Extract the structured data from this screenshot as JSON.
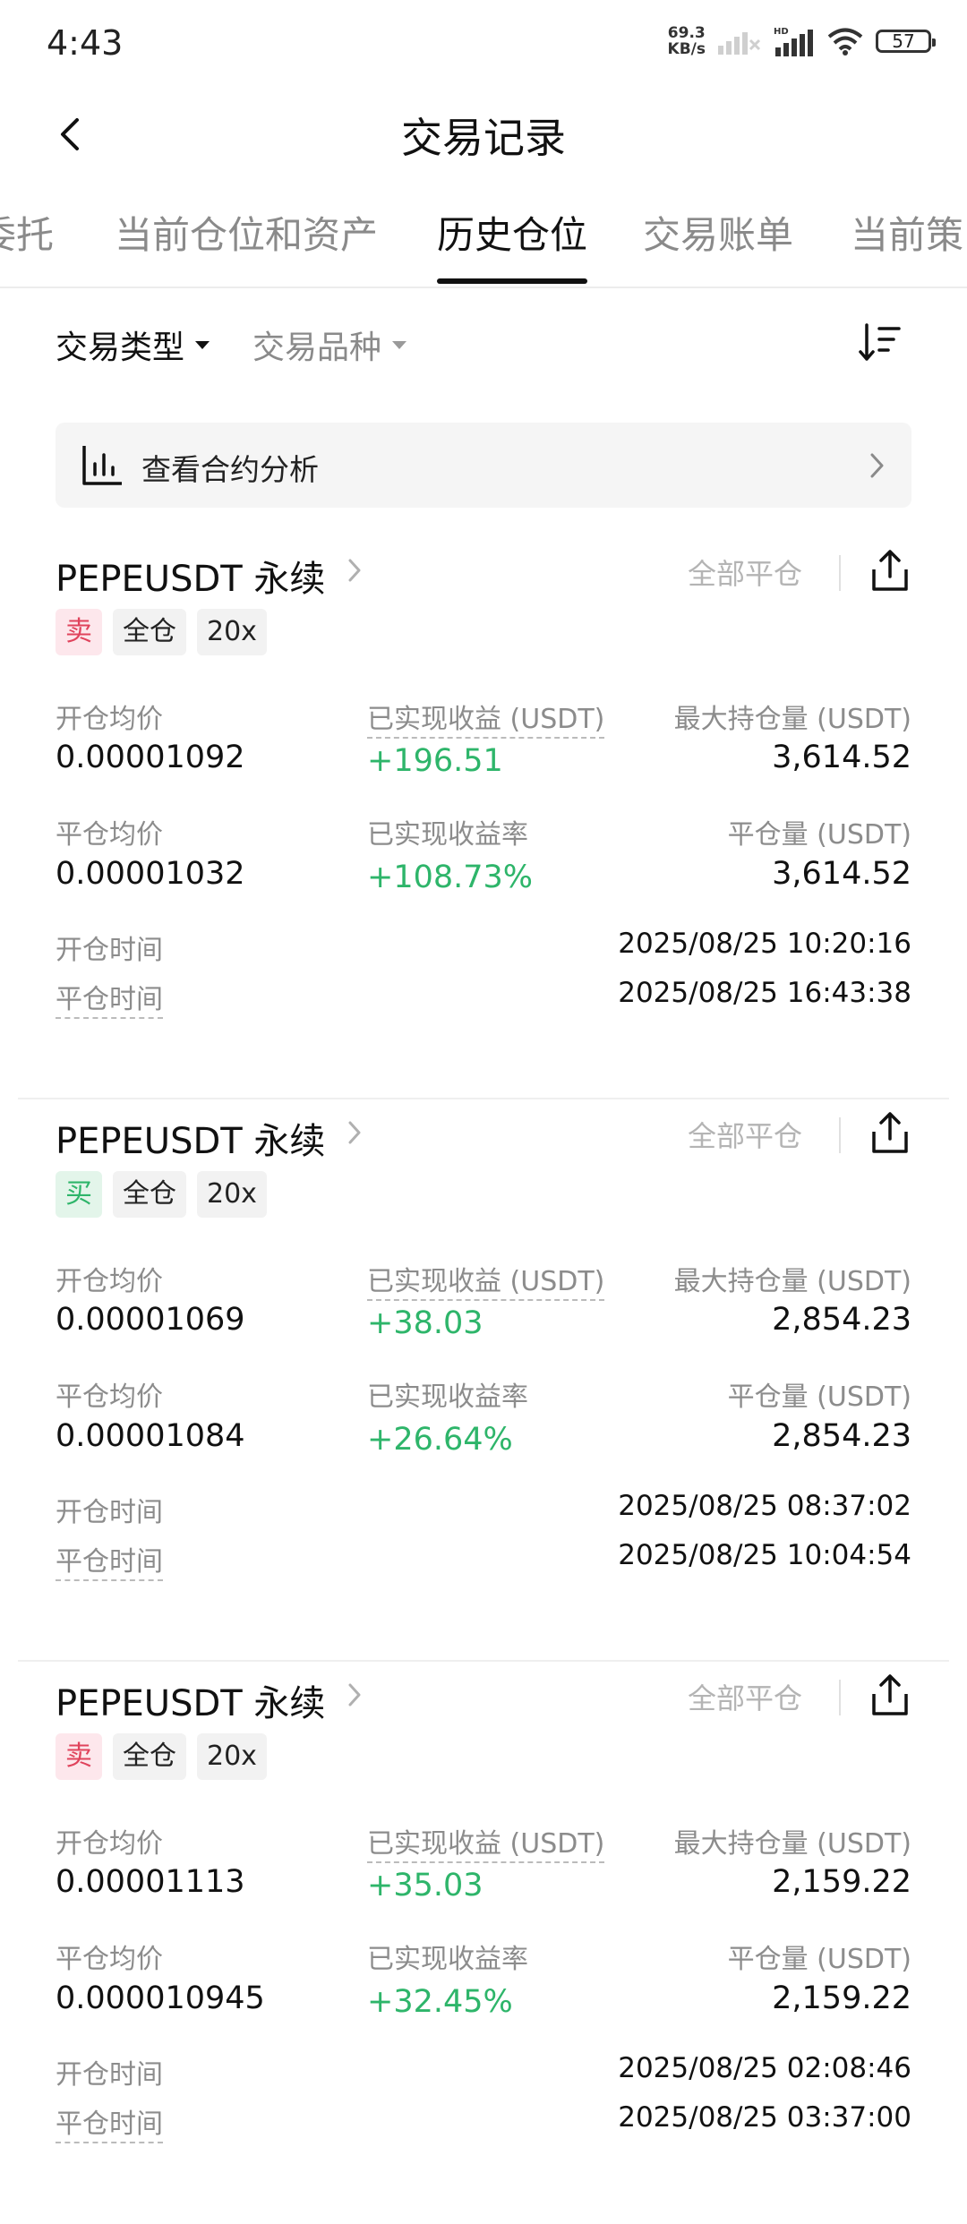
{
  "status": {
    "time": "4:43",
    "net_speed_value": "69.3",
    "net_speed_unit": "KB/s",
    "battery": "57",
    "icons": [
      "signal-icon",
      "hd-icon",
      "wifi-icon",
      "battery-icon"
    ]
  },
  "header": {
    "title": "交易记录",
    "back_icon": "back-chevron-icon"
  },
  "tabs": [
    "委托",
    "当前仓位和资产",
    "历史仓位",
    "交易账单",
    "当前策"
  ],
  "active_tab": "历史仓位",
  "filters": {
    "trade_type": "交易类型",
    "instrument": "交易品种",
    "sort_icon": "sort-icon"
  },
  "analysis": {
    "label": "查看合约分析"
  },
  "labels": {
    "open_avg": "开仓均价",
    "close_avg": "平仓均价",
    "realized_pnl": "已实现收益 (USDT)",
    "realized_pnl_rate": "已实现收益率",
    "max_position": "最大持仓量 (USDT)",
    "close_qty": "平仓量 (USDT)",
    "open_time": "开仓时间",
    "close_time": "平仓时间",
    "close_all": "全部平仓"
  },
  "colors": {
    "profit_green": "#2eb56a",
    "sell_red": "#e0435c"
  },
  "positions": [
    {
      "symbol": "PEPEUSDT 永续",
      "side": "卖",
      "margin_mode": "全仓",
      "leverage": "20x",
      "open_avg": "0.00001092",
      "close_avg": "0.00001032",
      "realized_pnl": "+196.51",
      "realized_pnl_rate": "+108.73%",
      "max_position": "3,614.52",
      "close_qty": "3,614.52",
      "open_time": "2025/08/25 10:20:16",
      "close_time": "2025/08/25 16:43:38"
    },
    {
      "symbol": "PEPEUSDT 永续",
      "side": "买",
      "margin_mode": "全仓",
      "leverage": "20x",
      "open_avg": "0.00001069",
      "close_avg": "0.00001084",
      "realized_pnl": "+38.03",
      "realized_pnl_rate": "+26.64%",
      "max_position": "2,854.23",
      "close_qty": "2,854.23",
      "open_time": "2025/08/25 08:37:02",
      "close_time": "2025/08/25 10:04:54"
    },
    {
      "symbol": "PEPEUSDT 永续",
      "side": "卖",
      "margin_mode": "全仓",
      "leverage": "20x",
      "open_avg": "0.00001113",
      "close_avg": "0.000010945",
      "realized_pnl": "+35.03",
      "realized_pnl_rate": "+32.45%",
      "max_position": "2,159.22",
      "close_qty": "2,159.22",
      "open_time": "2025/08/25 02:08:46",
      "close_time": "2025/08/25 03:37:00"
    }
  ]
}
